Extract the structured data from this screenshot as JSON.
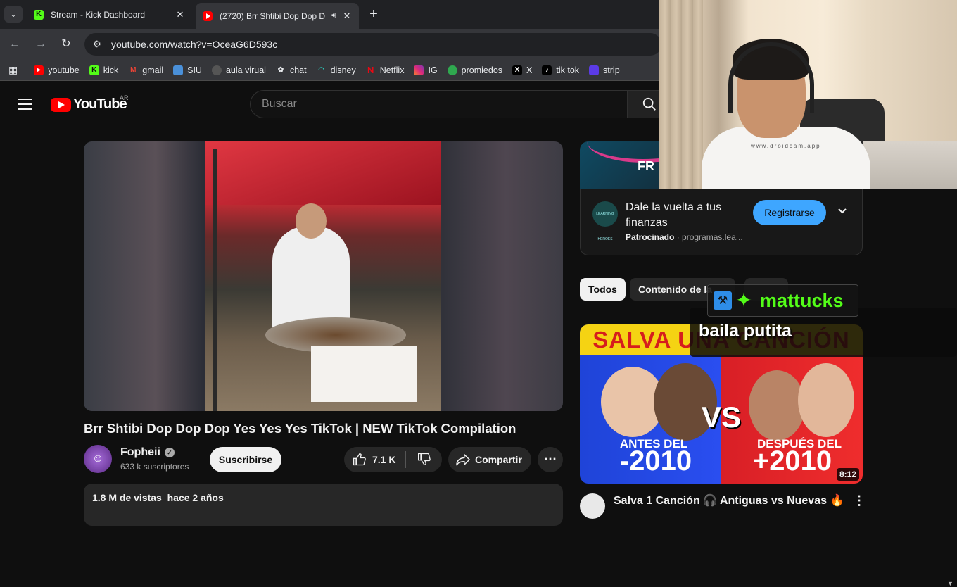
{
  "browser": {
    "tabs": [
      {
        "title": "Stream - Kick Dashboard"
      },
      {
        "title": "(2720) Brr Shtibi Dop Dop D"
      }
    ],
    "url": "youtube.com/watch?v=OceaG6D593c",
    "bookmarks": [
      "youtube",
      "kick",
      "gmail",
      "SIU",
      "aula virual",
      "chat",
      "disney",
      "Netflix",
      "IG",
      "promiedos",
      "X",
      "tik tok",
      "strip"
    ]
  },
  "youtube": {
    "logo_text": "YouTube",
    "country": "AR",
    "search_placeholder": "Buscar",
    "video": {
      "title": "Brr Shtibi Dop Dop Dop Yes Yes Yes TikTok | NEW TikTok Compilation",
      "channel": "Fopheii",
      "subscribers": "633 k suscriptores",
      "subscribe_label": "Suscribirse",
      "likes": "7.1 K",
      "share_label": "Compartir",
      "views": "1.8 M de vistas",
      "age": "hace 2 años"
    },
    "ad": {
      "banner_text": "FR",
      "title": "Dale la vuelta a tus finanzas",
      "sponsored": "Patrocinado",
      "domain": "programas.lea...",
      "cta": "Registrarse",
      "logo_text": "LEARNING HEROES"
    },
    "chips": [
      "Todos",
      "Contenido de la"
    ],
    "next": {
      "thumb_top": "SALVA UNA CANCIÓN",
      "left_label": "ANTES DEL",
      "left_big": "-2010",
      "right_label": "DESPUÉS DEL",
      "right_big": "+2010",
      "vs": "VS",
      "duration": "8:12",
      "title": "Salva 1 Canción 🎧 Antiguas vs Nuevas 🔥"
    }
  },
  "overlay": {
    "alert_user": "mattucks",
    "chat_message": "baila putita",
    "webcam_watermark": "www.droidcam.app"
  },
  "colors": {
    "kick_green": "#53fc18",
    "yt_red": "#ff0000",
    "cta_blue": "#3ea6ff"
  }
}
